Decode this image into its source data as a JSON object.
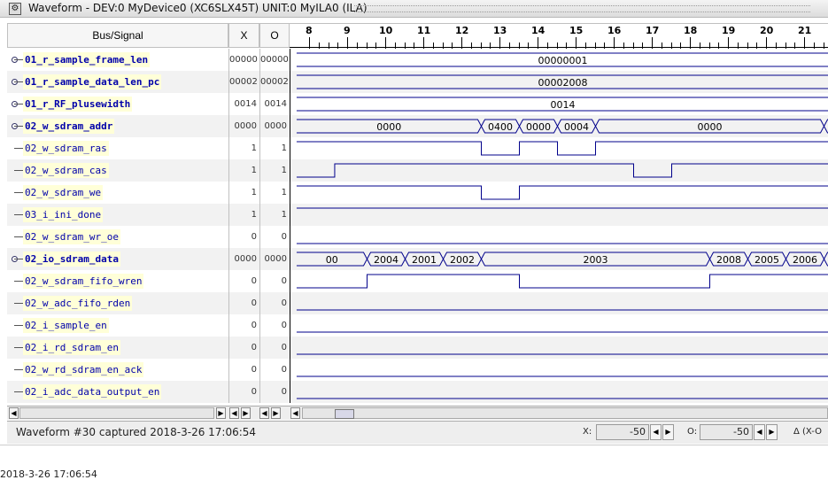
{
  "window": {
    "title": "Waveform - DEV:0 MyDevice0 (XC6SLX45T) UNIT:0 MyILA0 (ILA)",
    "icon": "waveform-app-icon"
  },
  "columns": {
    "signal": "Bus/Signal",
    "x": "X",
    "o": "O"
  },
  "ruler": {
    "ticks": [
      "8",
      "9",
      "10",
      "11",
      "12",
      "13",
      "14",
      "15",
      "16",
      "17",
      "18",
      "19",
      "20",
      "21"
    ]
  },
  "signals": [
    {
      "name": "01_r_sample_frame_len",
      "bus": true,
      "x": "00000",
      "o": "00000",
      "segments": [
        {
          "from": 7.65,
          "to": 22,
          "label": "00000001"
        }
      ]
    },
    {
      "name": "01_r_sample_data_len_pc",
      "bus": true,
      "x": "00002",
      "o": "00002",
      "segments": [
        {
          "from": 7.65,
          "to": 22,
          "label": "00002008"
        }
      ]
    },
    {
      "name": "01_r_RF_plusewidth",
      "bus": true,
      "x": "0014",
      "o": "0014",
      "segments": [
        {
          "from": 7.65,
          "to": 22,
          "label": "0014"
        }
      ]
    },
    {
      "name": "02_w_sdram_addr",
      "bus": true,
      "x": "0000",
      "o": "0000",
      "segments": [
        {
          "from": 7.65,
          "to": 12.5,
          "label": "0000"
        },
        {
          "from": 12.5,
          "to": 13.5,
          "label": "0400"
        },
        {
          "from": 13.5,
          "to": 14.5,
          "label": "0000"
        },
        {
          "from": 14.5,
          "to": 15.5,
          "label": "0004"
        },
        {
          "from": 15.5,
          "to": 21.5,
          "label": "0000"
        },
        {
          "from": 21.5,
          "to": 22,
          "label": ""
        }
      ]
    },
    {
      "name": "02_w_sdram_ras",
      "bus": false,
      "x": "1",
      "o": "1",
      "levels": [
        [
          7.65,
          1
        ],
        [
          12.5,
          0
        ],
        [
          13.5,
          1
        ],
        [
          14.5,
          0
        ],
        [
          15.5,
          1
        ],
        [
          22,
          1
        ]
      ]
    },
    {
      "name": "02_w_sdram_cas",
      "bus": false,
      "x": "1",
      "o": "1",
      "levels": [
        [
          7.65,
          0
        ],
        [
          8.65,
          1
        ],
        [
          16.5,
          0
        ],
        [
          17.5,
          1
        ],
        [
          22,
          1
        ]
      ]
    },
    {
      "name": "02_w_sdram_we",
      "bus": false,
      "x": "1",
      "o": "1",
      "levels": [
        [
          7.65,
          1
        ],
        [
          12.5,
          0
        ],
        [
          13.5,
          1
        ],
        [
          22,
          1
        ]
      ]
    },
    {
      "name": "03_i_ini_done",
      "bus": false,
      "x": "1",
      "o": "1",
      "levels": [
        [
          7.65,
          1
        ],
        [
          22,
          1
        ]
      ]
    },
    {
      "name": "02_w_sdram_wr_oe",
      "bus": false,
      "x": "0",
      "o": "0",
      "levels": [
        [
          7.65,
          0
        ],
        [
          22,
          0
        ]
      ]
    },
    {
      "name": "02_io_sdram_data",
      "bus": true,
      "x": "0000",
      "o": "0000",
      "segments": [
        {
          "from": 7.65,
          "to": 9.5,
          "label": "00"
        },
        {
          "from": 9.5,
          "to": 10.5,
          "label": "2004"
        },
        {
          "from": 10.5,
          "to": 11.5,
          "label": "2001"
        },
        {
          "from": 11.5,
          "to": 12.5,
          "label": "2002"
        },
        {
          "from": 12.5,
          "to": 18.5,
          "label": "2003"
        },
        {
          "from": 18.5,
          "to": 19.5,
          "label": "2008"
        },
        {
          "from": 19.5,
          "to": 20.5,
          "label": "2005"
        },
        {
          "from": 20.5,
          "to": 21.5,
          "label": "2006"
        },
        {
          "from": 21.5,
          "to": 22,
          "label": ""
        }
      ]
    },
    {
      "name": "02_w_sdram_fifo_wren",
      "bus": false,
      "x": "0",
      "o": "0",
      "levels": [
        [
          7.65,
          0
        ],
        [
          9.5,
          1
        ],
        [
          13.5,
          0
        ],
        [
          18.5,
          1
        ],
        [
          22,
          1
        ]
      ]
    },
    {
      "name": "02_w_adc_fifo_rden",
      "bus": false,
      "x": "0",
      "o": "0",
      "levels": [
        [
          7.65,
          0
        ],
        [
          22,
          0
        ]
      ]
    },
    {
      "name": "02_i_sample_en",
      "bus": false,
      "x": "0",
      "o": "0",
      "levels": [
        [
          7.65,
          0
        ],
        [
          22,
          0
        ]
      ]
    },
    {
      "name": "02_i_rd_sdram_en",
      "bus": false,
      "x": "0",
      "o": "0",
      "levels": [
        [
          7.65,
          0
        ],
        [
          22,
          0
        ]
      ]
    },
    {
      "name": "02_w_rd_sdram_en_ack",
      "bus": false,
      "x": "0",
      "o": "0",
      "levels": [
        [
          7.65,
          0
        ],
        [
          22,
          0
        ]
      ]
    },
    {
      "name": "02_i_adc_data_output_en",
      "bus": false,
      "x": "0",
      "o": "0",
      "levels": [
        [
          7.65,
          0
        ],
        [
          22,
          0
        ]
      ]
    }
  ],
  "status": {
    "text": "Waveform #30 captured 2018-3-26 17:06:54",
    "x_label": "X:",
    "x_value": "-50",
    "o_label": "O:",
    "o_value": "-50",
    "delta_label": "Δ (X-O"
  },
  "bottom": {
    "text": "2018-3-26 17:06:54"
  }
}
